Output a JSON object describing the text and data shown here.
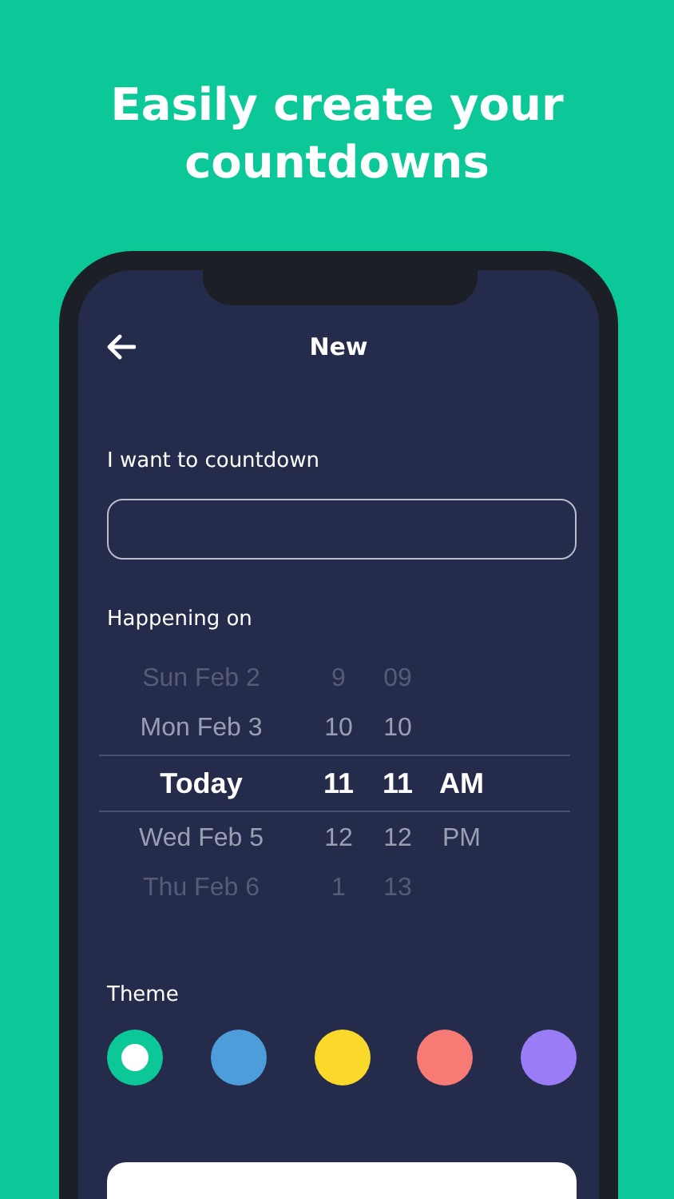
{
  "headline": "Easily create your countdowns",
  "screen": {
    "title": "New",
    "name_field": {
      "label": "I want to countdown"
    },
    "date_picker": {
      "label": "Happening on",
      "rows": [
        {
          "date": "Sun Feb 2",
          "hour": "9",
          "minute": "09",
          "period": "",
          "selected": false
        },
        {
          "date": "Mon Feb 3",
          "hour": "10",
          "minute": "10",
          "period": "",
          "selected": false
        },
        {
          "date": "Today",
          "hour": "11",
          "minute": "11",
          "period": "AM",
          "selected": true
        },
        {
          "date": "Wed Feb 5",
          "hour": "12",
          "minute": "12",
          "period": "PM",
          "selected": false
        },
        {
          "date": "Thu Feb 6",
          "hour": "1",
          "minute": "13",
          "period": "",
          "selected": false
        }
      ]
    },
    "theme": {
      "label": "Theme",
      "colors": [
        {
          "color": "#0cc899",
          "selected": true
        },
        {
          "color": "#4e9ddb",
          "selected": false
        },
        {
          "color": "#fbd92a",
          "selected": false
        },
        {
          "color": "#f77a75",
          "selected": false
        },
        {
          "color": "#9a7cf7",
          "selected": false
        }
      ]
    }
  }
}
